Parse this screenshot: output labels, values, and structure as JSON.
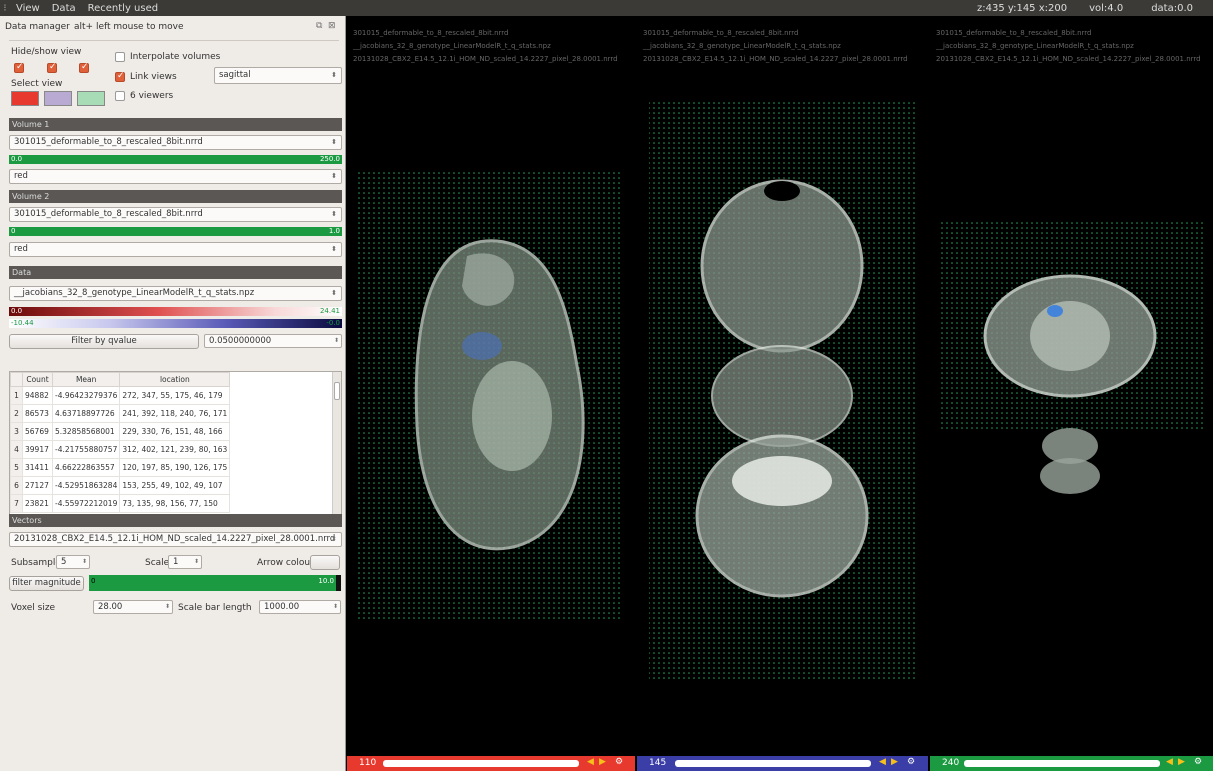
{
  "menubar": {
    "grip": "⁝",
    "items": [
      "View",
      "Data",
      "Recently used"
    ]
  },
  "status": {
    "coords": "z:435 y:145 x:200",
    "vol": "vol:4.0",
    "data": "data:0.0"
  },
  "left": {
    "title": "Data manager",
    "hint": "alt+ left mouse to move",
    "hide_show": "Hide/show view",
    "select_view": "Select view",
    "interpolate": "Interpolate volumes",
    "link_views": "Link views",
    "six_viewers": "6 viewers",
    "orientation": "sagittal",
    "swatch_colors": [
      "#e8392e",
      "#b9aad4",
      "#a8dcb6"
    ],
    "volume1": {
      "header": "Volume 1",
      "file": "301015_deformable_to_8_rescaled_8bit.nrrd",
      "min": "0.0",
      "max": "250.0",
      "lut": "red"
    },
    "volume2": {
      "header": "Volume 2",
      "file": "301015_deformable_to_8_rescaled_8bit.nrrd",
      "min": "0",
      "max": "1.0",
      "lut": "red"
    },
    "data": {
      "header": "Data",
      "file": "__jacobians_32_8_genotype_LinearModelR_t_q_stats.npz",
      "pos_min": "0.0",
      "pos_max": "24.41",
      "neg_min": "-10.44",
      "neg_max": "-0.0",
      "filter_btn": "Filter by qvalue",
      "qvalue": "0.0500000000"
    },
    "table": {
      "headers": [
        "",
        "Count",
        "Mean",
        "location"
      ],
      "rows": [
        [
          "1",
          "94882",
          "-4.96423279376",
          "272, 347, 55, 175, 46, 179"
        ],
        [
          "2",
          "86573",
          "4.63718897726",
          "241, 392, 118, 240, 76, 171"
        ],
        [
          "3",
          "56769",
          "5.32858568001",
          "229, 330, 76, 151, 48, 166"
        ],
        [
          "4",
          "39917",
          "-4.21755880757",
          "312, 402, 121, 239, 80, 163"
        ],
        [
          "5",
          "31411",
          "4.66222863557",
          "120, 197, 85, 190, 126, 175"
        ],
        [
          "6",
          "27127",
          "-4.52951863284",
          "153, 255, 49, 102, 49, 107"
        ],
        [
          "7",
          "23821",
          "-4.55972212019",
          "73, 135, 98, 156, 77, 150"
        ]
      ]
    },
    "vectors": {
      "header": "Vectors",
      "file": "20131028_CBX2_E14.5_12.1i_HOM_ND_scaled_14.2227_pixel_28.0001.nrrd",
      "subsample_label": "Subsample",
      "subsample": "5",
      "scale_label": "Scale",
      "scale": "1",
      "arrow_colour": "Arrow colour",
      "filter_mag": "filter magnitude",
      "mag_min": "0",
      "mag_max": "10.0"
    },
    "voxel_label": "Voxel size",
    "voxel": "28.00",
    "scalebar_label": "Scale bar length",
    "scalebar": "1000.00"
  },
  "views": [
    {
      "lines": [
        "301015_deformable_to_8_rescaled_8bit.nrrd",
        "__jacobians_32_8_genotype_LinearModelR_t_q_stats.npz",
        "20131028_CBX2_E14.5_12.1i_HOM_ND_scaled_14.2227_pixel_28.0001.nrrd"
      ],
      "slice": "110",
      "color": "#e8392e"
    },
    {
      "lines": [
        "301015_deformable_to_8_rescaled_8bit.nrrd",
        "__jacobians_32_8_genotype_LinearModelR_t_q_stats.npz",
        "20131028_CBX2_E14.5_12.1i_HOM_ND_scaled_14.2227_pixel_28.0001.nrrd"
      ],
      "slice": "145",
      "color": "#3a3ea6"
    },
    {
      "lines": [
        "301015_deformable_to_8_rescaled_8bit.nrrd",
        "__jacobians_32_8_genotype_LinearModelR_t_q_stats.npz",
        "20131028_CBX2_E14.5_12.1i_HOM_ND_scaled_14.2227_pixel_28.0001.nrrd"
      ],
      "slice": "240",
      "color": "#1b9a42"
    }
  ]
}
